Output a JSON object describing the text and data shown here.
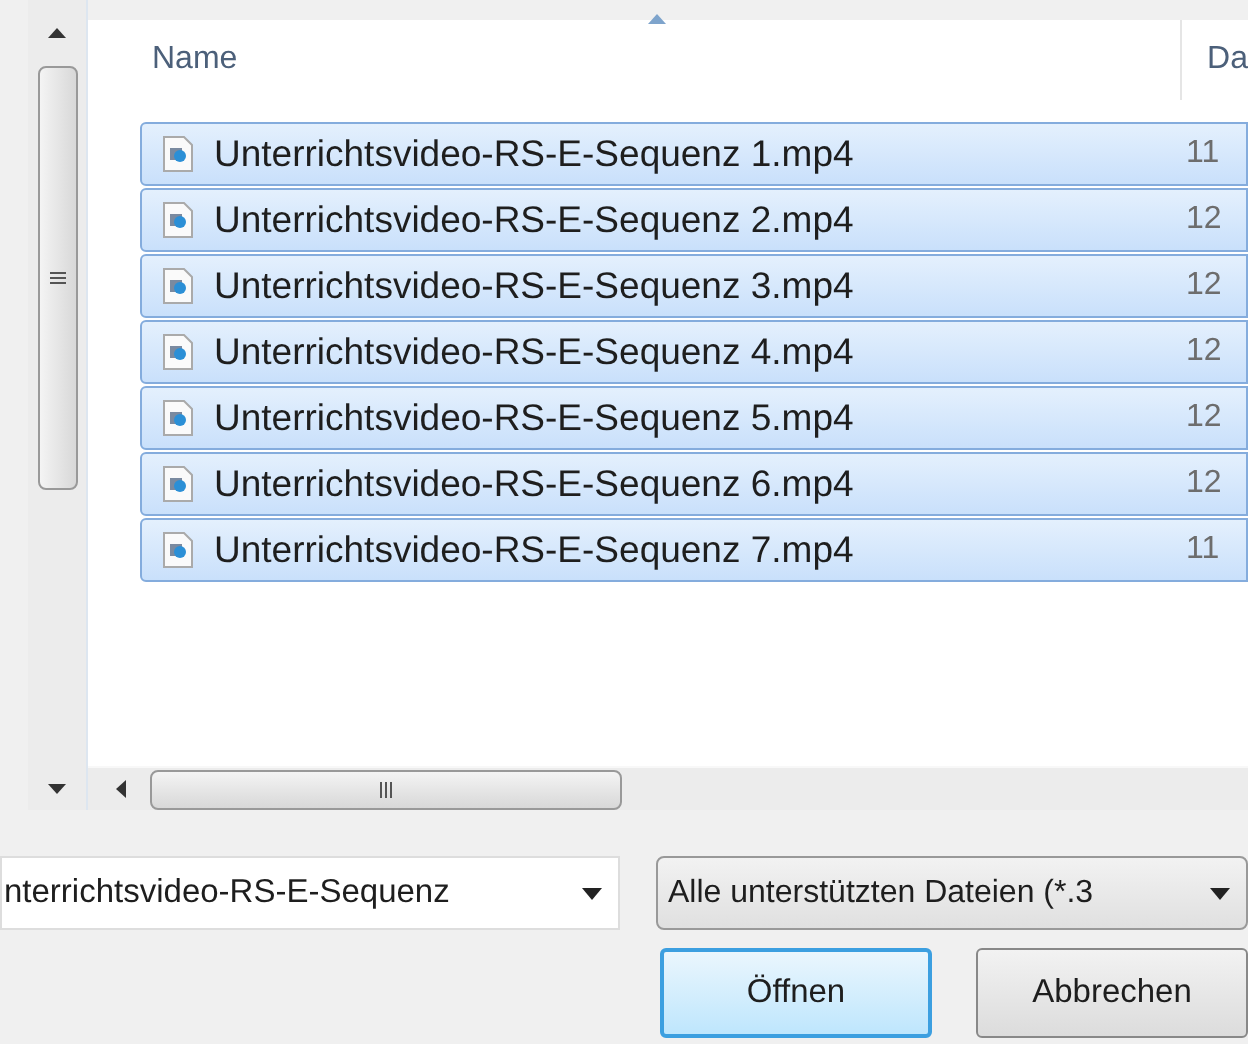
{
  "file_list": {
    "columns": [
      {
        "label": "Name",
        "sorted": true
      },
      {
        "label": "Da"
      }
    ],
    "rows": [
      {
        "name": "Unterrichtsvideo-RS-E-Sequenz 1.mp4",
        "date": "11",
        "selected": true
      },
      {
        "name": "Unterrichtsvideo-RS-E-Sequenz 2.mp4",
        "date": "12",
        "selected": true
      },
      {
        "name": "Unterrichtsvideo-RS-E-Sequenz 3.mp4",
        "date": "12",
        "selected": true
      },
      {
        "name": "Unterrichtsvideo-RS-E-Sequenz 4.mp4",
        "date": "12",
        "selected": true
      },
      {
        "name": "Unterrichtsvideo-RS-E-Sequenz 5.mp4",
        "date": "12",
        "selected": true
      },
      {
        "name": "Unterrichtsvideo-RS-E-Sequenz 6.mp4",
        "date": "12",
        "selected": true
      },
      {
        "name": "Unterrichtsvideo-RS-E-Sequenz 7.mp4",
        "date": "11",
        "selected": true
      }
    ]
  },
  "file_name_field": {
    "value": "nterrichtsvideo-RS-E-Sequenz"
  },
  "file_type_dropdown": {
    "value": "Alle unterstützten Dateien (*.3"
  },
  "buttons": [
    {
      "label": "Öffnen",
      "default": true
    },
    {
      "label": "Abbrechen",
      "default": false
    }
  ]
}
